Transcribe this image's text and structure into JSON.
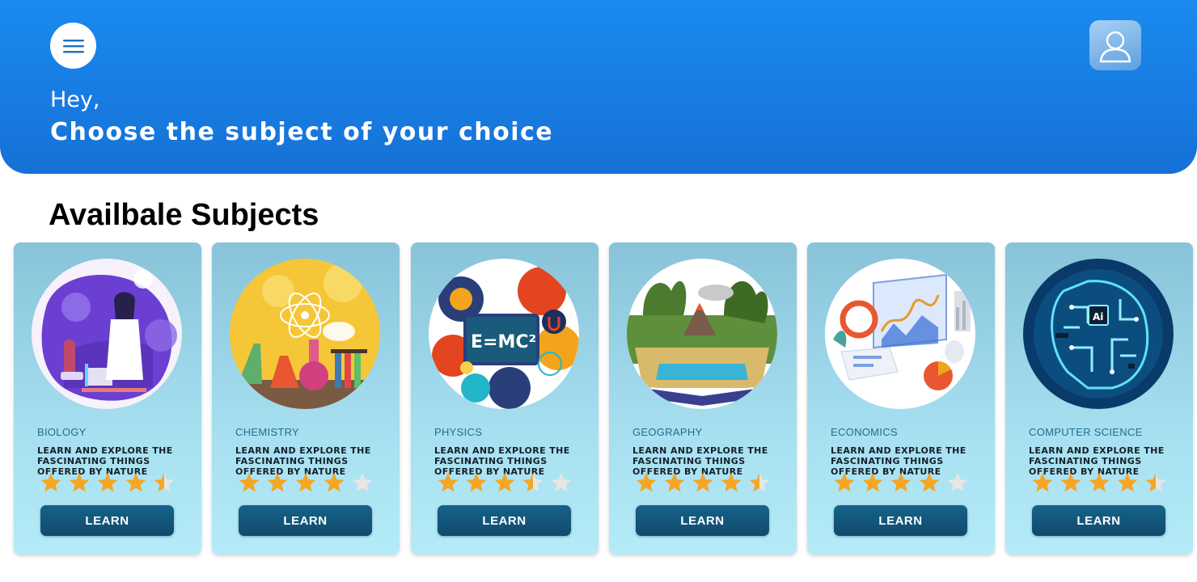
{
  "header": {
    "greeting": "Hey,",
    "headline": "Choose the subject of your choice",
    "menu_icon": "hamburger-menu-icon",
    "profile_icon": "user-profile-icon"
  },
  "section": {
    "title": "Availbale Subjects"
  },
  "colors": {
    "header_blue": "#1a8af0",
    "card_bg": "#a6dff0",
    "button_bg": "#135a80",
    "star_filled": "#f5a623",
    "star_empty": "#e6e6e6"
  },
  "subjects": [
    {
      "name": "BIOLOGY",
      "description": "LEARN AND EXPLORE THE FASCINATING THINGS OFFERED BY NATURE",
      "rating": 4.5,
      "button": "LEARN",
      "illustration": "scientist-illustration"
    },
    {
      "name": "CHEMISTRY",
      "description": "LEARN AND EXPLORE THE FASCINATING THINGS OFFERED BY NATURE",
      "rating": 4,
      "button": "LEARN",
      "illustration": "chemistry-flasks-illustration"
    },
    {
      "name": "PHYSICS",
      "description": "LEARN AND EXPLORE THE FASCINATING THINGS OFFERED BY NATURE",
      "rating": 3.5,
      "button": "LEARN",
      "illustration": "physics-emc2-illustration"
    },
    {
      "name": "GEOGRAPHY",
      "description": "LEARN AND EXPLORE THE FASCINATING THINGS OFFERED BY NATURE",
      "rating": 4.5,
      "button": "LEARN",
      "illustration": "open-book-landscape-illustration"
    },
    {
      "name": "ECONOMICS",
      "description": "LEARN AND EXPLORE THE FASCINATING THINGS OFFERED BY NATURE",
      "rating": 4,
      "button": "LEARN",
      "illustration": "analytics-charts-illustration"
    },
    {
      "name": "COMPUTER SCIENCE",
      "description": "LEARN AND EXPLORE THE FASCINATING THINGS OFFERED BY NATURE",
      "rating": 4.5,
      "button": "LEARN",
      "illustration": "ai-circuit-brain-illustration"
    }
  ]
}
